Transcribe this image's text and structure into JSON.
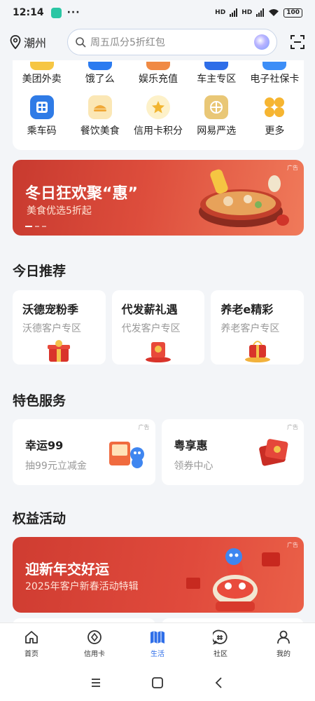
{
  "status_bar": {
    "time": "12:14",
    "dots": "···",
    "signal1": "HD",
    "signal2": "HD",
    "battery": "100"
  },
  "header": {
    "location": "潮州",
    "search_placeholder": "周五瓜分5折红包"
  },
  "top_grid": {
    "row1": [
      {
        "label": "美团外卖",
        "color": "#f6c643"
      },
      {
        "label": "饿了么",
        "color": "#2b7bf0"
      },
      {
        "label": "娱乐充值",
        "color": "#f08a44"
      },
      {
        "label": "车主专区",
        "color": "#2f6ee8"
      },
      {
        "label": "电子社保卡",
        "color": "#3d8ef7"
      }
    ],
    "row2": [
      {
        "label": "乘车码",
        "icon": "bus-card-icon",
        "color": "#2f7be6"
      },
      {
        "label": "餐饮美食",
        "icon": "food-icon",
        "color": "#f5c45a"
      },
      {
        "label": "信用卡积分",
        "icon": "star-points-icon",
        "color": "#f2c94c"
      },
      {
        "label": "网易严选",
        "icon": "netease-icon",
        "color": "#e8c777"
      },
      {
        "label": "更多",
        "icon": "more-grid-icon",
        "color": "#f5b531"
      }
    ]
  },
  "banner": {
    "title": "冬日狂欢聚“惠”",
    "subtitle": "美食优选5折起",
    "ad": "广告"
  },
  "today": {
    "title": "今日推荐",
    "cards": [
      {
        "title": "沃德宠粉季",
        "subtitle": "沃德客户专区"
      },
      {
        "title": "代发薪礼遇",
        "subtitle": "代发客户专区"
      },
      {
        "title": "养老e精彩",
        "subtitle": "养老客户专区"
      }
    ]
  },
  "featured": {
    "title": "特色服务",
    "cards": [
      {
        "title": "幸运99",
        "subtitle": "抽99元立减金",
        "ad": "广告"
      },
      {
        "title": "粤享惠",
        "subtitle": "领券中心",
        "ad": "广告"
      }
    ]
  },
  "benefits": {
    "title": "权益活动",
    "banner": {
      "title": "迎新年交好运",
      "subtitle": "2025年客户新春活动特辑",
      "ad": "广告"
    }
  },
  "bottom_nav": [
    {
      "label": "首页",
      "icon": "home-icon",
      "active": false
    },
    {
      "label": "信用卡",
      "icon": "compass-icon",
      "active": false
    },
    {
      "label": "生活",
      "icon": "life-icon",
      "active": true
    },
    {
      "label": "社区",
      "icon": "community-icon",
      "active": false
    },
    {
      "label": "我的",
      "icon": "profile-icon",
      "active": false
    }
  ],
  "colors": {
    "accent": "#2f6ee8",
    "banner_red": "#d8463a",
    "background": "#f3f5f8"
  }
}
